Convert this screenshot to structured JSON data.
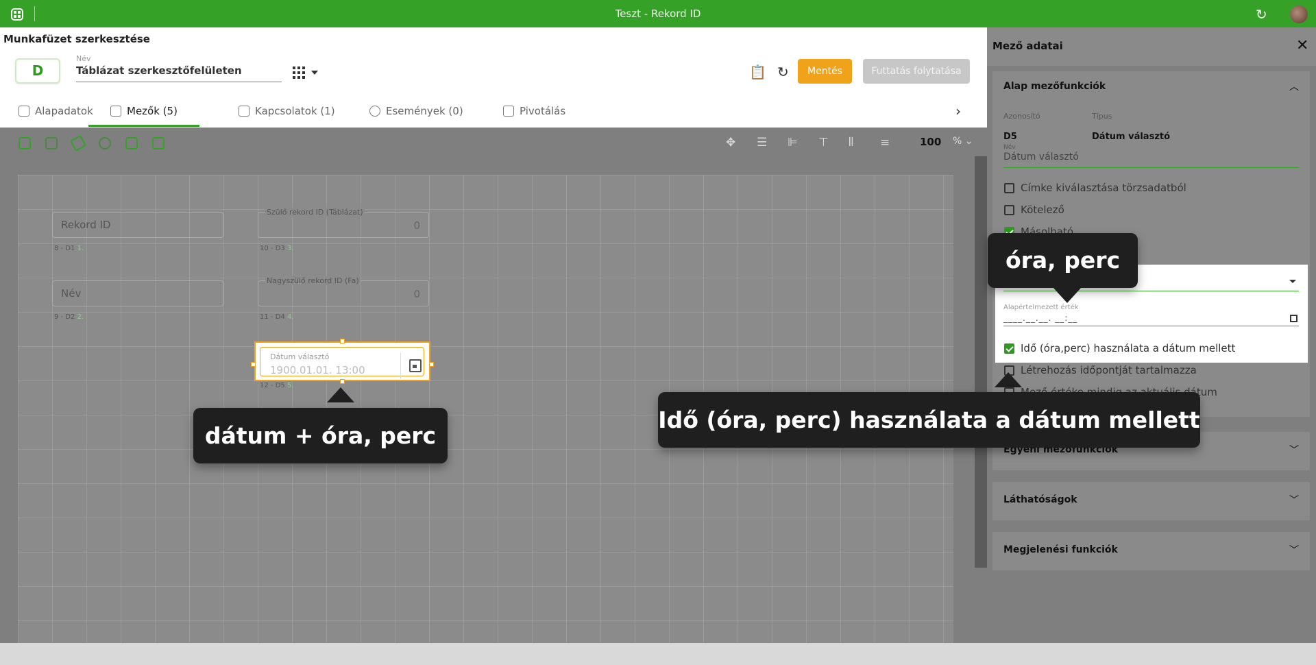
{
  "window": {
    "title": "Teszt - Rekord ID"
  },
  "header": {
    "page_title": "Munkafüzet szerkesztése",
    "badge": "D",
    "name_label": "Név",
    "name_value": "Táblázat szerkesztőfelületen",
    "save_label": "Mentés",
    "run_label": "Futtatás folytatása"
  },
  "tabs": [
    {
      "label": "Alapadatok",
      "icon": "database-icon"
    },
    {
      "label": "Mezők (5)",
      "icon": "field-icon"
    },
    {
      "label": "Kapcsolatok (1)",
      "icon": "relations-icon"
    },
    {
      "label": "Események (0)",
      "icon": "timer-icon"
    },
    {
      "label": "Pivotálás",
      "icon": "pivot-icon"
    }
  ],
  "canvas": {
    "zoom_value": "100",
    "zoom_unit": "%",
    "fields": [
      {
        "value": "Rekord ID",
        "meta": "8 - D1",
        "meta_num": "1."
      },
      {
        "legend": "Szülő rekord ID (Táblázat)",
        "value": "0",
        "meta": "10 - D3",
        "meta_num": "3."
      },
      {
        "value": "Név",
        "meta": "9 - D2",
        "meta_num": "2."
      },
      {
        "legend": "Nagyszülő rekord ID (Fa)",
        "value": "0",
        "meta": "11 - D4",
        "meta_num": "4."
      }
    ],
    "date_field": {
      "label": "Dátum választó",
      "value": "1900.01.01. 13:00",
      "meta": "12 - D5",
      "meta_num": "5."
    }
  },
  "panel": {
    "title": "Mező adatai",
    "section_basic": "Alap mezőfunkciók",
    "id_label": "Azonosító",
    "id_value": "D5",
    "type_label": "Típus",
    "type_value": "Dátum választó",
    "name_label": "Név",
    "name_value": "Dátum választó",
    "checkboxes": [
      {
        "label": "Címke kiválasztása törzsadatból",
        "checked": false
      },
      {
        "label": "Kötelező",
        "checked": false
      },
      {
        "label": "Másolható",
        "checked": true
      },
      {
        "label": "Idő (óra,perc) használata a dátum mellett",
        "checked": true
      },
      {
        "label": "Létrehozás időpontját tartalmazza",
        "checked": false
      },
      {
        "label": "Mező értéke mindig az aktuális dátum",
        "checked": false
      }
    ],
    "default_label": "Alapértelmezett érték",
    "default_value": "____.__.__. __:__",
    "section_custom": "Egyéni mezőfunkciók",
    "section_visibility": "Láthatóságok",
    "section_display": "Megjelenési funkciók"
  },
  "tooltips": {
    "ora_perc": "óra, perc",
    "datum_ora_perc": "dátum + óra, perc",
    "ido_hasznalata": "Idő (óra, perc) használata a dátum mellett"
  },
  "colors": {
    "brand_green": "#35a227",
    "accent_orange": "#f0a21a",
    "tooltip_bg": "#1f1f1f"
  }
}
